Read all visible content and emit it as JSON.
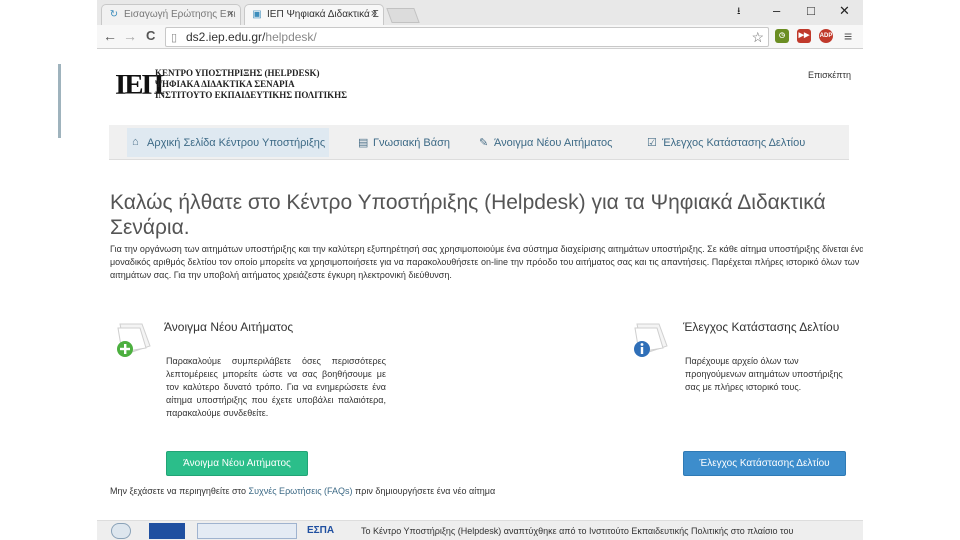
{
  "browser": {
    "tabs": [
      {
        "label": "Εισαγωγή Ερώτησης Επι",
        "active": false
      },
      {
        "label": "ΙΕΠ Ψηφιακά Διδακτικά Σ",
        "active": true
      }
    ],
    "tab_close": "×",
    "window_controls": {
      "minimize": "–",
      "maximize": "□",
      "close": "✕"
    },
    "toolbar": {
      "back": "←",
      "forward": "→",
      "reload": "C",
      "menu": "≡"
    },
    "url_host": "ds2.iep.edu.gr/",
    "url_path": "helpdesk/",
    "star": "☆",
    "extensions": [
      {
        "name": "clock-extension-icon",
        "glyph": "◷",
        "color": "#6b8e23"
      },
      {
        "name": "forward-extension-icon",
        "glyph": "▶▶",
        "color": "#c0392b"
      },
      {
        "name": "adblock-extension-icon",
        "glyph": "ADP",
        "color": "#c0392b"
      }
    ]
  },
  "site": {
    "logo": "ΙΕΠ",
    "title_lines": [
      "ΚΕΝΤΡΟ ΥΠΟΣΤΗΡΙΞΗΣ (HELPDESK)",
      "ΨΗΦΙΑΚΑ ΔΙΔΑΚΤΙΚΑ ΣΕΝΑΡΙΑ",
      "ΙΝΣΤΙΤΟΥΤΟ ΕΚΠΑΙΔΕΥΤΙΚΗΣ ΠΟΛΙΤΙΚΗΣ"
    ],
    "login_label": "Επισκέπτη"
  },
  "nav": [
    {
      "label": "Αρχική Σελίδα Κέντρου Υποστήριξης",
      "icon": "⌂",
      "active": true
    },
    {
      "label": "Γνωσιακή Βάση",
      "icon": "▤",
      "active": false
    },
    {
      "label": "Άνοιγμα Νέου Αιτήματος",
      "icon": "✎",
      "active": false
    },
    {
      "label": "Έλεγχος Κατάστασης Δελτίου",
      "icon": "☑",
      "active": false
    }
  ],
  "main": {
    "heading": "Καλώς ήλθατε στο Κέντρο Υποστήριξης (Helpdesk) για τα Ψηφιακά Διδακτικά Σενάρια.",
    "intro": "Για την οργάνωση των αιτημάτων υποστήριξης και την καλύτερη εξυπηρέτησή σας χρησιμοποιούμε ένα σύστημα διαχείρισης αιτημάτων υποστήριξης. Σε κάθε αίτημα υποστήριξης δίνεται ένας μοναδικός αριθμός δελτίου τον οποίο μπορείτε να χρησιμοποιήσετε για να παρακολουθήσετε on-line την πρόοδο του αιτήματος σας και τις απαντήσεις. Παρέχεται πλήρες ιστορικό όλων των αιτημάτων σας. Για την υποβολή αιτήματος χρειάζεστε έγκυρη ηλεκτρονική διεύθυνση.",
    "new_ticket": {
      "title": "Άνοιγμα Νέου Αιτήματος",
      "description": "Παρακαλούμε συμπεριλάβετε όσες περισσότερες λεπτομέρειες μπορείτε ώστε να σας βοηθήσουμε με τον καλύτερο δυνατό τρόπο. Για να ενημερώσετε ένα αίτημα υποστήριξης που έχετε υποβάλει παλαιότερα, παρακαλούμε συνδεθείτε.",
      "button": "Άνοιγμα Νέου Αιτήματος"
    },
    "check_status": {
      "title": "Έλεγχος Κατάστασης Δελτίου",
      "description": "Παρέχουμε αρχείο όλων των προηγούμενων αιτημάτων υποστήριξης σας με πλήρες ιστορικό τους.",
      "button": "Έλεγχος Κατάστασης Δελτίου"
    },
    "faq_prefix": "Μην ξεχάσετε να περιηγηθείτε στο ",
    "faq_link": "Συχνές Ερωτήσεις (FAQs)",
    "faq_suffix": " πριν δημιουργήσετε ένα νέο αίτημα"
  },
  "footer": {
    "espa": "ΕΣΠΑ",
    "text": "Το Κέντρο Υποστήριξης (Helpdesk) αναπτύχθηκε από το Ινστιτούτο Εκπαιδευτικής Πολιτικής στο πλαίσιο του"
  }
}
